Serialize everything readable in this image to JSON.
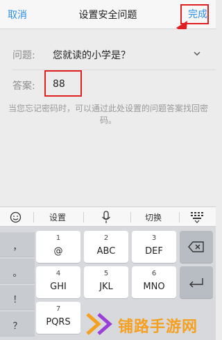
{
  "header": {
    "cancel_label": "取消",
    "title": "设置安全问题",
    "done_label": "完成"
  },
  "form": {
    "question_label": "问题:",
    "question_value": "您就读的小学是？",
    "answer_label": "答案:",
    "answer_value": "88",
    "hint": "当您忘记密码时，可以通过此处设置的问题答案找回密码。"
  },
  "keyboard_toolbar": {
    "items": [
      "设置",
      "切换"
    ],
    "icons": [
      "emoji-icon",
      "microphone-icon",
      "keyboard-collapse-icon"
    ]
  },
  "keyboard": {
    "side_keys": [
      "，",
      "。",
      "！",
      "？"
    ],
    "keys": [
      {
        "num": "1",
        "letters": "@"
      },
      {
        "num": "2",
        "letters": "ABC"
      },
      {
        "num": "3",
        "letters": "DEF"
      },
      {
        "num": "4",
        "letters": "GHI"
      },
      {
        "num": "5",
        "letters": "JKL"
      },
      {
        "num": "6",
        "letters": "MNO"
      },
      {
        "num": "7",
        "letters": "PQRS"
      }
    ],
    "action_icons": [
      "backspace-icon",
      "enter-icon"
    ]
  },
  "watermark": {
    "text": "铺路手游网"
  },
  "colors": {
    "accent": "#2d8fe5",
    "annotation_red": "#e02020",
    "watermark_orange": "#f5a020"
  }
}
